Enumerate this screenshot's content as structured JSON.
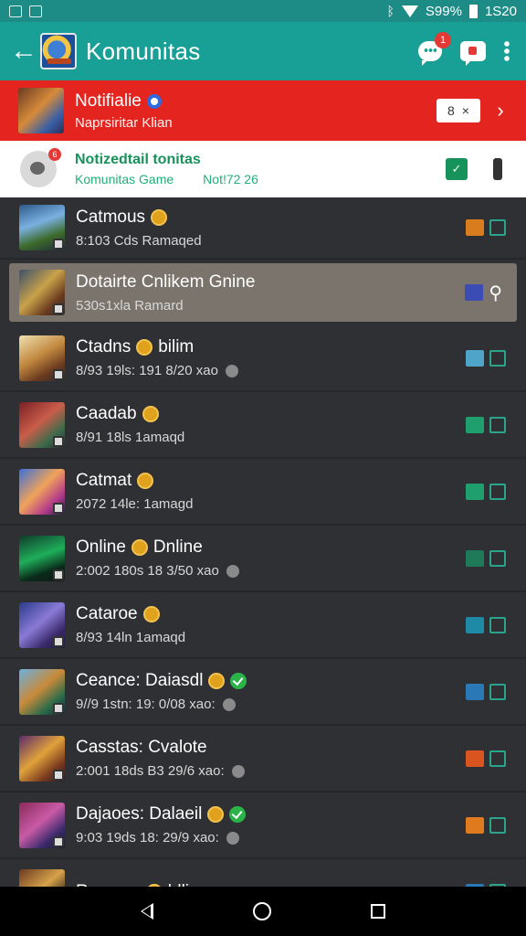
{
  "status_bar": {
    "battery_text": "S99%",
    "time": "1:20",
    "time_full": "1S20"
  },
  "app_bar": {
    "title": "Komunitas",
    "chat_badge": "1"
  },
  "red_banner": {
    "title": "Notifialie",
    "subtitle": "Naprsiritar Klian",
    "chip_label": "8",
    "chip_close": "×"
  },
  "community_card": {
    "title": "Notizedtail tonitas",
    "subtitle": "Komunitas Game",
    "meta": "Not!72 26",
    "badge": "6"
  },
  "rows": [
    {
      "title": "Catmous",
      "subtitle": "8:103 Cds  Ramaqed",
      "medal": true,
      "verified": false,
      "grey": false,
      "act_color": "#d97c1e",
      "box": true,
      "thumb": "linear-gradient(160deg,#2c5a8a,#7ab0e0 40%,#3d6b2a 70%,#1e2b3a)"
    },
    {
      "title": "Dotairte Cnlikem Gnine",
      "subtitle": "530s1xla  Ramard",
      "medal": false,
      "verified": false,
      "grey": false,
      "act_color": "#3b4db5",
      "box": false,
      "selected": true,
      "thumb": "linear-gradient(135deg,#3a4f6b,#c9a24a 45%,#6a3b1f 75%,#2b2b2b)"
    },
    {
      "title": "Ctadns",
      "title_extra": "bilim",
      "subtitle": "8/93 19ls:  191 8/20 xao",
      "medal": true,
      "verified": false,
      "grey": true,
      "act_color": "#4ea5c9",
      "box": true,
      "thumb": "linear-gradient(150deg,#f0e1b0,#c1883f 45%,#6b3a1f 75%,#2a2a2a)"
    },
    {
      "title": "Caadab",
      "subtitle": "8/91 18ls  1amaqd",
      "medal": true,
      "verified": false,
      "grey": false,
      "act_color": "#1f9e6e",
      "box": true,
      "thumb": "linear-gradient(140deg,#7a1f24,#c95d4a 45%,#3b6b4a 75%,#2a2a2a)"
    },
    {
      "title": "Catmat",
      "subtitle": "2072 14le:  1amagd",
      "medal": true,
      "verified": false,
      "grey": false,
      "act_color": "#1f9e6e",
      "box": true,
      "thumb": "linear-gradient(135deg,#3b6fd6,#f0a35a 45%,#b33a8a 75%,#1e2244)"
    },
    {
      "title": "Online",
      "title_extra": "Dnline",
      "subtitle": "2:002 180s  18 3/50 xao",
      "medal": true,
      "verified": false,
      "grey": true,
      "act_color": "#1f7a5a",
      "box": true,
      "thumb": "linear-gradient(160deg,#0f3a2a,#1fae5a 45%,#0a2a1a 75%,#101a14)"
    },
    {
      "title": "Cataroe",
      "subtitle": "8/93 14ln  1amaqd",
      "medal": true,
      "verified": false,
      "grey": false,
      "act_color": "#1f8aa6",
      "box": true,
      "thumb": "linear-gradient(140deg,#2a3a8a,#8a7ad6 45%,#3b2a6b 75%,#1a1a3a)"
    },
    {
      "title": "Ceance: Daiasdl",
      "subtitle": "9//9 1stn:  19: 0/08 xao:",
      "medal": true,
      "verified": true,
      "grey": true,
      "act_color": "#2a78b5",
      "box": true,
      "thumb": "linear-gradient(140deg,#6ab0e0,#c98a3a 45%,#2a6b4a 75%,#1a2a3a)"
    },
    {
      "title": "Casstas: Cvalote",
      "subtitle": "2:001 18ds  B3 29/6 xao:",
      "medal": false,
      "verified": false,
      "grey": true,
      "act_color": "#d9541e",
      "box": true,
      "thumb": "linear-gradient(140deg,#5a2a6b,#e0a23a 45%,#7a3a1f 75%,#2a1a2a)"
    },
    {
      "title": "Dajaoes: Dalaeil",
      "subtitle": "9:03 19ds  18: 29/9 xao:",
      "medal": true,
      "verified": true,
      "grey": true,
      "act_color": "#e07a1e",
      "box": true,
      "thumb": "linear-gradient(140deg,#8a2a5a,#c95aa6 45%,#3a2a6b 75%,#1a1a2a)"
    },
    {
      "title": "Reesau:",
      "title_extra": "bllio",
      "subtitle": "",
      "medal": true,
      "verified": false,
      "grey": false,
      "act_color": "#2a78b5",
      "box": true,
      "thumb": "linear-gradient(140deg,#6b3a1f,#d6a24a 45%,#3a2a1f 75%,#1a1a1a)"
    }
  ]
}
